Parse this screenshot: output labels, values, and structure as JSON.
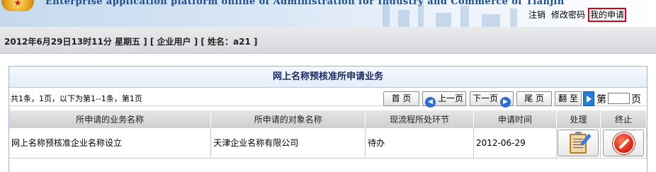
{
  "header": {
    "subtitle_en": "Enterprise application platform online of Administration for Industry and Commerce of Tianjin",
    "links": [
      "注销",
      "修改密码",
      "我的申请"
    ],
    "active_link": "我的申请"
  },
  "info_bar": {
    "text": "2012年6月29日13时11分 星期五 ] [ 企业用户 ] [ 姓名：a21 ]"
  },
  "panel": {
    "title": "网上名称预核准所申请业务"
  },
  "pager": {
    "summary": "共1条，1页，以下为第1--1条，第1页",
    "first": "首 页",
    "prev": "上一页",
    "next": "下一页",
    "last": "尾 页",
    "goto": "翻 至",
    "page_prefix": "第",
    "page_suffix": "页",
    "page_input": ""
  },
  "table": {
    "columns": [
      "所申请的业务名称",
      "所申请的对象名称",
      "现流程所处环节",
      "申请时间",
      "处理",
      "终止"
    ],
    "rows": [
      {
        "business": "网上名称预核准企业名称设立",
        "object": "天津企业名称有限公司",
        "stage": "待办",
        "time": "2012-06-29"
      }
    ]
  }
}
